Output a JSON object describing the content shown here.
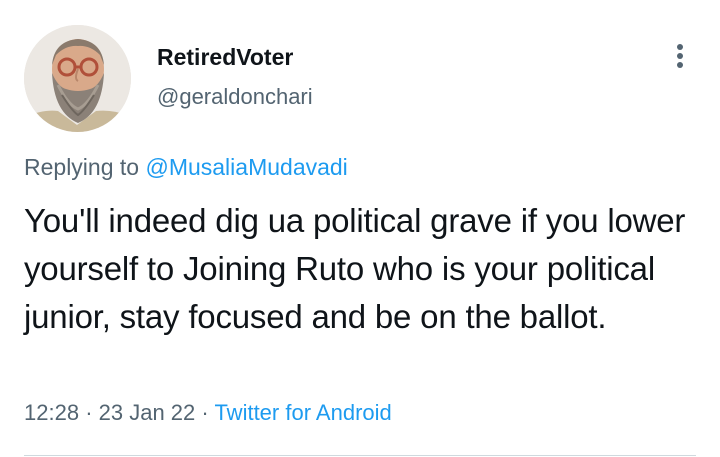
{
  "author": {
    "display_name": "RetiredVoter",
    "handle": "@geraldonchari",
    "avatar_icon": "profile-photo"
  },
  "more_icon": "more-vertical-icon",
  "reply": {
    "prefix": "Replying to",
    "mention": "@MusaliaMudavadi"
  },
  "tweet": {
    "text": "You'll indeed dig ua political grave if you lower yourself to Joining Ruto who is your political junior, stay focused and be on the ballot."
  },
  "meta": {
    "time": "12:28",
    "separator": "·",
    "date": "23 Jan 22",
    "source": "Twitter for Android"
  },
  "colors": {
    "link": "#1d9bf0",
    "secondary_text": "#536471",
    "primary_text": "#0f1419",
    "divider": "#cfd9de"
  }
}
